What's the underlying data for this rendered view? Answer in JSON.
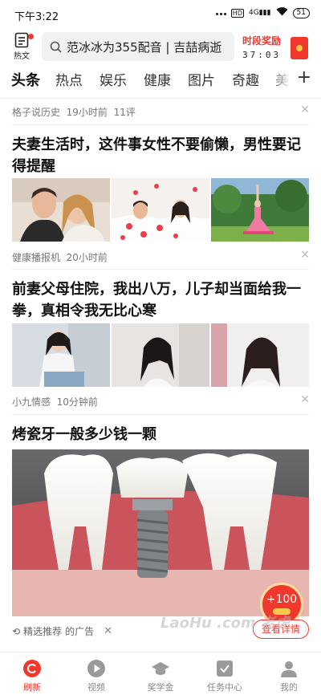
{
  "status_bar": {
    "time": "下午3:22",
    "hd": "HD",
    "network": "4G",
    "battery": "51"
  },
  "header": {
    "hot_doc_label": "热文",
    "search_query": "范冰冰为355配音 | 吉喆病逝",
    "reward_title": "时段奖励",
    "countdown": "37:03"
  },
  "tabs": [
    {
      "label": "头条",
      "active": true
    },
    {
      "label": "热点"
    },
    {
      "label": "娱乐"
    },
    {
      "label": "健康"
    },
    {
      "label": "图片"
    },
    {
      "label": "奇趣"
    },
    {
      "label": "美"
    }
  ],
  "top_meta": {
    "source": "格子说历史",
    "time": "19小时前",
    "comments": "11评"
  },
  "articles": [
    {
      "title": "夫妻生活时，这件事女性不要偷懒，男性要记得提醒",
      "source": "健康播报机",
      "time": "20小时前"
    },
    {
      "title": "前妻父母住院，我出八万，儿子却当面给我一拳，真相令我无比心寒",
      "source": "小九情感",
      "time": "10分钟前"
    }
  ],
  "ad": {
    "title": "烤瓷牙一般多少钱一颗",
    "recommend": "精选推荐",
    "ad_label": "的广告",
    "cta": "查看详情",
    "bonus": "+100",
    "watermark": "LaoHu .com 老虎"
  },
  "bottom_nav": [
    {
      "label": "刷新",
      "icon": "refresh-icon",
      "active": true
    },
    {
      "label": "视频",
      "icon": "video-icon"
    },
    {
      "label": "奖学金",
      "icon": "scholarship-icon"
    },
    {
      "label": "任务中心",
      "icon": "task-icon"
    },
    {
      "label": "我的",
      "icon": "profile-icon"
    }
  ],
  "colors": {
    "accent": "#f0382d",
    "text": "#222222",
    "meta": "#777777"
  }
}
